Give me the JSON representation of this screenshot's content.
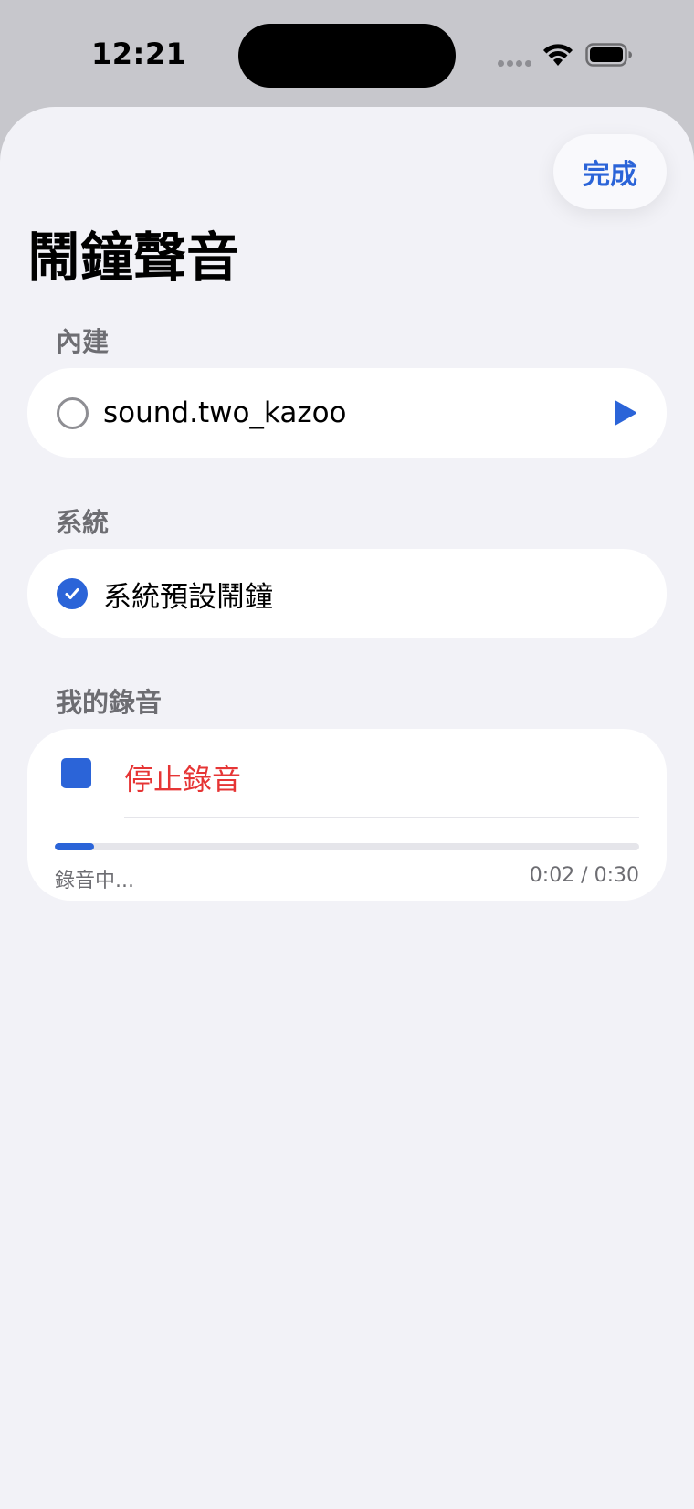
{
  "status_bar": {
    "time": "12:21"
  },
  "header": {
    "done_label": "完成",
    "title": "鬧鐘聲音"
  },
  "sections": {
    "builtin": {
      "header": "內建",
      "item_label": "sound.two_kazoo",
      "selected": false
    },
    "system": {
      "header": "系統",
      "item_label": "系統預設鬧鐘",
      "selected": true
    },
    "recordings": {
      "header": "我的錄音",
      "stop_label": "停止錄音",
      "status": "錄音中...",
      "time": "0:02 / 0:30",
      "progress_fraction": 0.0667
    }
  },
  "icons": {
    "builtin_radio": "radio-unchecked-icon",
    "play": "play-icon",
    "system_radio": "checkmark-circle-icon",
    "stop": "stop-square-icon"
  },
  "colors": {
    "accent": "#2b64d8",
    "destructive": "#e63535",
    "secondary_text": "#6d6d72"
  }
}
